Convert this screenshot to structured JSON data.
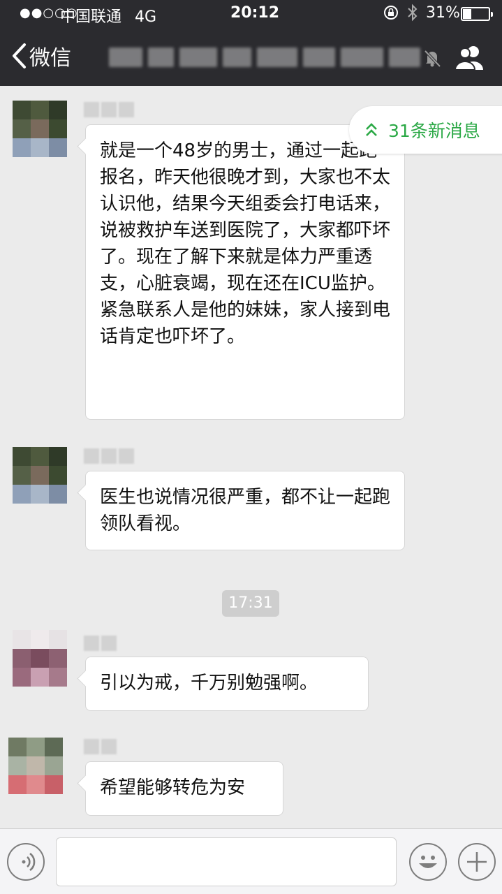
{
  "status_bar": {
    "signal": "●●○○○",
    "carrier": "中国联通",
    "network": "4G",
    "time": "20:12",
    "battery_percent": "31%",
    "battery_level": 0.31
  },
  "nav": {
    "back_label": "微信",
    "chat_title_obscured": true
  },
  "new_messages_badge": {
    "text": "31条新消息",
    "color": "#2aa845"
  },
  "messages": [
    {
      "type": "text",
      "text": "就是一个48岁的男士，通过一起跑报名，昨天他很晚才到，大家也不太认识他，结果今天组委会打电话来，说被救护车送到医院了，大家都吓坏了。现在了解下来就是体力严重透支，心脏衰竭，现在还在ICU监护。紧急联系人是他的妹妹，家人接到电话肯定也吓坏了。"
    },
    {
      "type": "text",
      "text": "医生也说情况很严重，都不让一起跑领队看视。"
    },
    {
      "type": "time",
      "text": "17:31"
    },
    {
      "type": "text",
      "text": "引以为戒，千万别勉强啊。"
    },
    {
      "type": "text",
      "text": "希望能够转危为安"
    }
  ],
  "colors": {
    "nav_bg": "#2b2b2f",
    "chat_bg": "#ebebeb",
    "accent_green": "#2aa845"
  },
  "icons": [
    "back-chevron-icon",
    "mute-bell-icon",
    "chat-members-icon",
    "double-chevron-up-icon",
    "voice-icon",
    "emoji-icon",
    "plus-icon"
  ]
}
